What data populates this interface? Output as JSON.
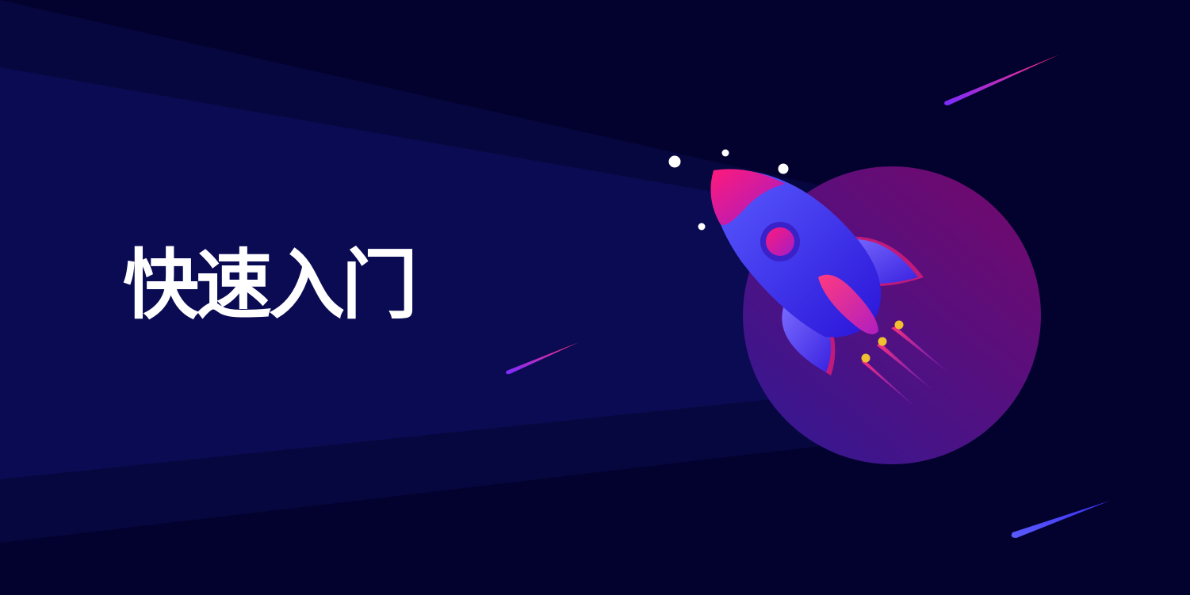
{
  "banner": {
    "title": "快速入门"
  },
  "colors": {
    "background": "#03022e",
    "light_beam": "#0a0a52",
    "planet_top": "#6d0a75",
    "planet_bottom": "#3d1590",
    "rocket_body": "#3b2df2",
    "rocket_accent": "#e3196b",
    "flame_dot": "#f0c030"
  },
  "icons": {
    "illustration": "rocket-icon",
    "planet": "planet-icon"
  }
}
